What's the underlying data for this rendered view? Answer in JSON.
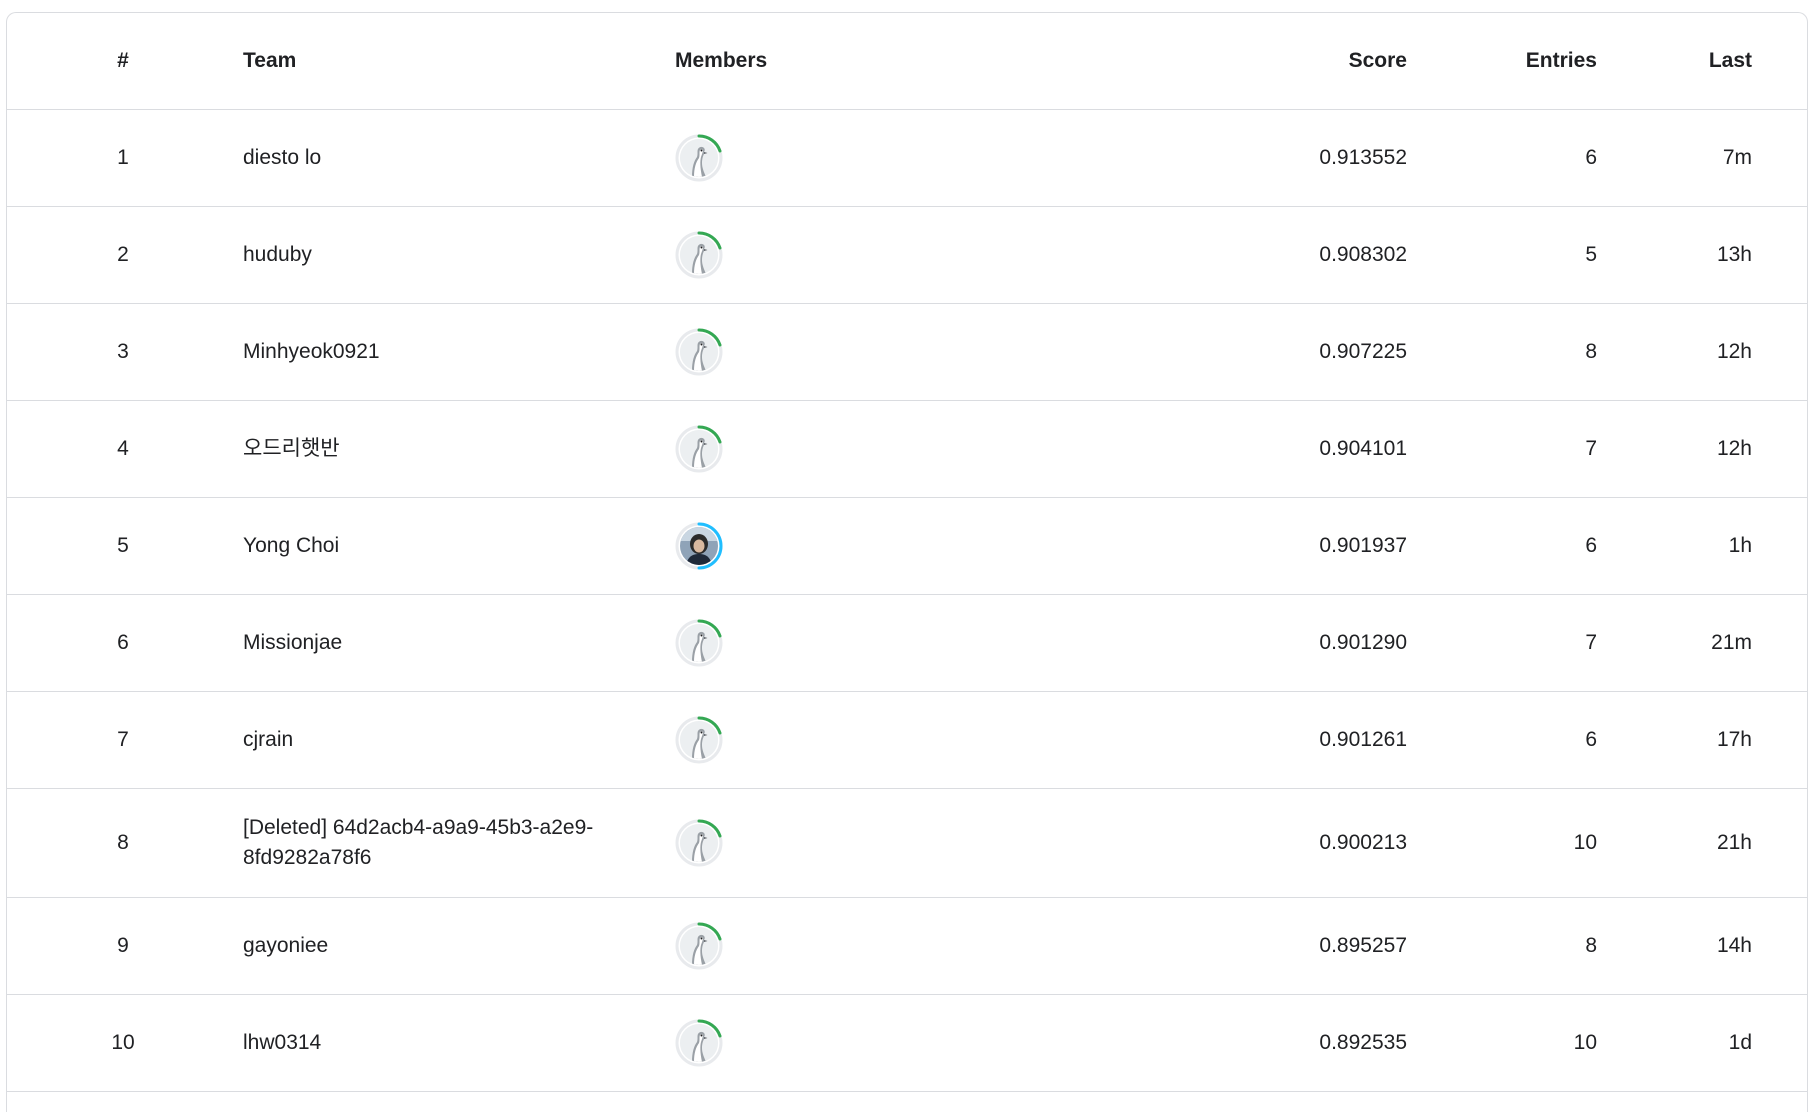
{
  "header": {
    "rank": "#",
    "team": "Team",
    "members": "Members",
    "score": "Score",
    "entries": "Entries",
    "last": "Last"
  },
  "rows": [
    {
      "rank": "1",
      "team": "diesto lo",
      "score": "0.913552",
      "entries": "6",
      "last": "7m",
      "avatar": "default-goose-avatar",
      "ring_color": "#34a853"
    },
    {
      "rank": "2",
      "team": "huduby",
      "score": "0.908302",
      "entries": "5",
      "last": "13h",
      "avatar": "default-goose-avatar",
      "ring_color": "#34a853"
    },
    {
      "rank": "3",
      "team": "Minhyeok0921",
      "score": "0.907225",
      "entries": "8",
      "last": "12h",
      "avatar": "default-goose-avatar",
      "ring_color": "#34a853"
    },
    {
      "rank": "4",
      "team": "오드리햇반",
      "score": "0.904101",
      "entries": "7",
      "last": "12h",
      "avatar": "default-goose-avatar",
      "ring_color": "#34a853"
    },
    {
      "rank": "5",
      "team": "Yong Choi",
      "score": "0.901937",
      "entries": "6",
      "last": "1h",
      "avatar": "user-photo-avatar",
      "ring_color": "#20beff"
    },
    {
      "rank": "6",
      "team": "Missionjae",
      "score": "0.901290",
      "entries": "7",
      "last": "21m",
      "avatar": "default-goose-avatar",
      "ring_color": "#34a853"
    },
    {
      "rank": "7",
      "team": "cjrain",
      "score": "0.901261",
      "entries": "6",
      "last": "17h",
      "avatar": "default-goose-avatar",
      "ring_color": "#34a853"
    },
    {
      "rank": "8",
      "team": "[Deleted] 64d2acb4-a9a9-45b3-a2e9-8fd9282a78f6",
      "score": "0.900213",
      "entries": "10",
      "last": "21h",
      "avatar": "default-goose-avatar",
      "ring_color": "#34a853"
    },
    {
      "rank": "9",
      "team": "gayoniee",
      "score": "0.895257",
      "entries": "8",
      "last": "14h",
      "avatar": "default-goose-avatar",
      "ring_color": "#34a853"
    },
    {
      "rank": "10",
      "team": "lhw0314",
      "score": "0.892535",
      "entries": "10",
      "last": "1d",
      "avatar": "default-goose-avatar",
      "ring_color": "#34a853"
    }
  ]
}
